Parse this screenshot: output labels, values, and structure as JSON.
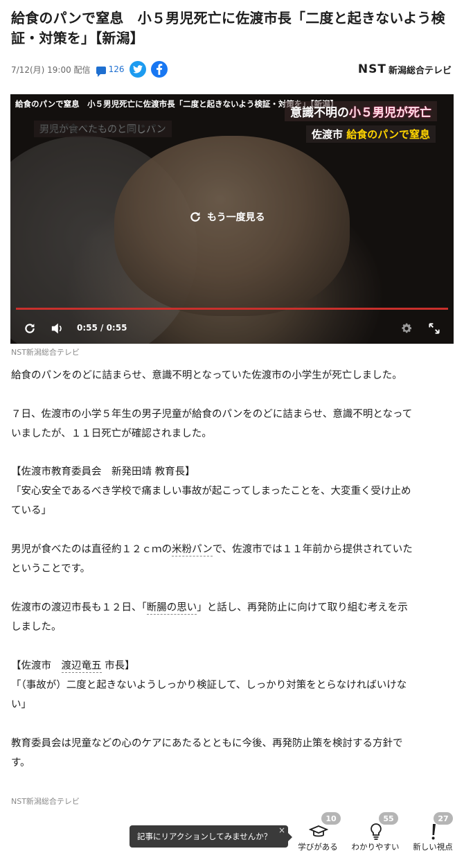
{
  "article": {
    "title": "給食のパンで窒息　小５男児死亡に佐渡市長「二度と起きないよう検証・対策を」【新潟】",
    "date": "7/12(月) 19:00",
    "status": "配信",
    "comment_count": "126"
  },
  "provider": {
    "logo_mark": "NST",
    "logo_name": "新潟総合テレビ"
  },
  "video": {
    "overlay_title": "給食のパンで窒息　小５男児死亡に佐渡市長「二度と起きないよう検証・対策を」【新潟】",
    "telop_left": "男児が食べたものと同じパン",
    "telop_right_top_a": "意識不明の",
    "telop_right_top_b": "小５男児が死亡",
    "telop_right_mid_a": "佐渡市",
    "telop_right_mid_b": "給食のパンで窒息",
    "replay_label": "もう一度見る",
    "time": "0:55 / 0:55",
    "progress": 1.0,
    "credit": "NST新潟総合テレビ"
  },
  "body": {
    "p1": "給食のパンをのどに詰まらせ、意識不明となっていた佐渡市の小学生が死亡しました。",
    "p2_l1": "７日、佐渡市の小学５年生の男子児童が給食のパンをのどに詰まらせ、意識不明となって",
    "p2_l2": "いましたが、１１日死亡が確認されました。",
    "p3_l1": "【佐渡市教育委員会　新発田靖 教育長】",
    "p3_l2": "「安心安全であるべき学校で痛ましい事故が起こってしまったことを、大変重く受け止め",
    "p3_l3": "ている」",
    "p4_a": "男児が食べたのは直径約１２ｃｍの",
    "p4_link": "米粉パン",
    "p4_b": "で、佐渡市では１１年前から提供されていた",
    "p4_l2": "ということです。",
    "p5_a": "佐渡市の渡辺市長も１２日、「",
    "p5_link": "断腸の思い",
    "p5_b": "」と話し、再発防止に向けて取り組む考えを示",
    "p5_l2": "しました。",
    "p6_a": "【佐渡市　",
    "p6_link": "渡辺竜五",
    "p6_b": " 市長】",
    "p6_l2": "「（事故が）二度と起きないようしっかり検証して、しっかり対策をとらなければいけな",
    "p6_l3": "い」",
    "p7_l1": "教育委員会は児童などの心のケアにあたるとともに今後、再発防止策を検討する方針で",
    "p7_l2": "す。"
  },
  "footer_credit": "NST新潟総合テレビ",
  "reactions": {
    "tip": "記事にリアクションしてみませんか？",
    "tip_close": "×",
    "items": [
      {
        "label": "学びがある",
        "count": "10",
        "icon": "mortarboard-icon"
      },
      {
        "label": "わかりやすい",
        "count": "55",
        "icon": "lightbulb-icon"
      },
      {
        "label": "新しい視点",
        "count": "27",
        "icon": "exclamation-icon"
      }
    ]
  },
  "colors": {
    "accent_blue": "#1e6fd0",
    "twitter": "#1d9bf0",
    "facebook": "#1877f2",
    "progress_red": "#c9302c"
  }
}
